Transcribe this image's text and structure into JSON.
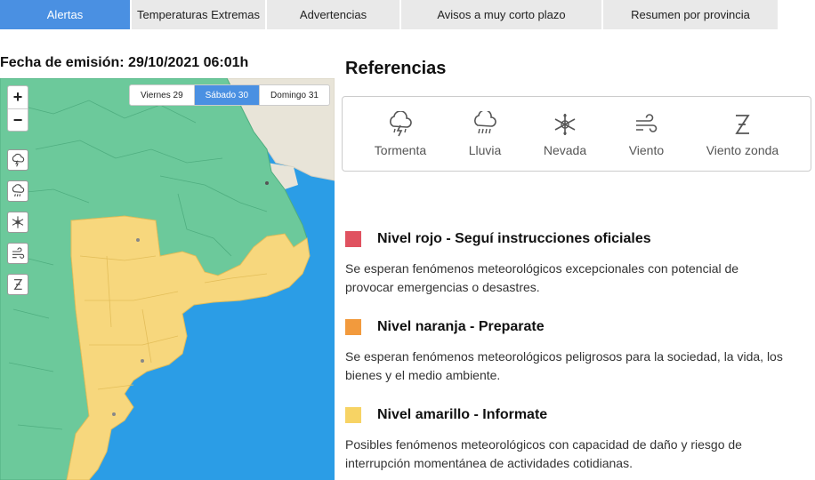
{
  "tabs": [
    {
      "label": "Alertas",
      "active": true
    },
    {
      "label": "Temperaturas Extremas",
      "active": false
    },
    {
      "label": "Advertencias",
      "active": false
    },
    {
      "label": "Avisos a muy corto plazo",
      "active": false
    },
    {
      "label": "Resumen por provincia",
      "active": false
    }
  ],
  "issue_date": "Fecha de emisión: 29/10/2021 06:01h",
  "map": {
    "zoom_in": "+",
    "zoom_out": "−",
    "days": [
      {
        "label": "Viernes 29",
        "active": false
      },
      {
        "label": "Sábado 30",
        "active": true
      },
      {
        "label": "Domingo 31",
        "active": false
      }
    ],
    "phenomenon_buttons": [
      "storm-icon",
      "rain-icon",
      "snow-icon",
      "wind-icon",
      "zonda-wind-icon"
    ],
    "colors": {
      "sea": "#2b9de6",
      "green_zone": "#6cc99b",
      "yellow_zone": "#f7d77d",
      "land_base": "#e8e4d8"
    }
  },
  "references": {
    "title": "Referencias",
    "items": [
      {
        "icon": "storm-icon",
        "label": "Tormenta"
      },
      {
        "icon": "rain-icon",
        "label": "Lluvia"
      },
      {
        "icon": "snow-icon",
        "label": "Nevada"
      },
      {
        "icon": "wind-icon",
        "label": "Viento"
      },
      {
        "icon": "zonda-wind-icon",
        "label": "Viento zonda"
      }
    ]
  },
  "levels": [
    {
      "color": "#e05260",
      "title": "Nivel rojo - Seguí instrucciones oficiales",
      "description": "Se esperan fenómenos meteorológicos excepcionales con potencial de provocar emergencias o desastres."
    },
    {
      "color": "#f29a3d",
      "title": "Nivel naranja - Preparate",
      "description": "Se esperan fenómenos meteorológicos peligrosos para la sociedad, la vida, los bienes y el medio ambiente."
    },
    {
      "color": "#f7d364",
      "title": "Nivel amarillo - Informate",
      "description": "Posibles fenómenos meteorológicos con capacidad de daño y riesgo de interrupción momentánea de actividades cotidianas."
    }
  ]
}
